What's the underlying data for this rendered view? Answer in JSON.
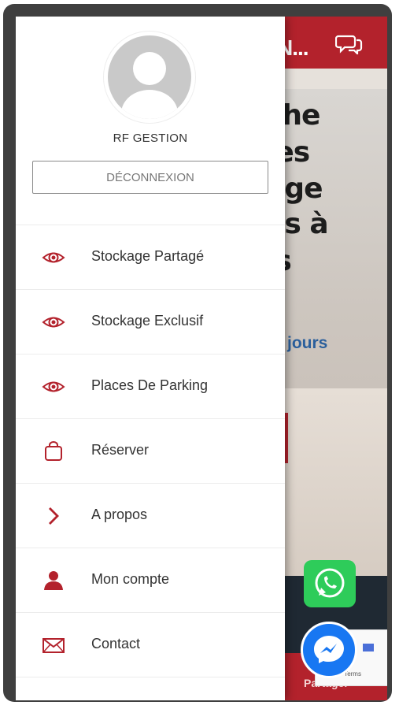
{
  "background_page": {
    "header_text": "N...",
    "headline_lines": [
      "che",
      "les",
      "age",
      "és à",
      "is"
    ],
    "link_text": "jours",
    "share_label": "Partager",
    "recaptcha_text": "Privacy - Terms"
  },
  "drawer": {
    "user_name": "RF GESTION",
    "logout_label": "DÉCONNEXION",
    "menu_items": [
      {
        "label": "Stockage Partagé",
        "icon": "eye-icon"
      },
      {
        "label": "Stockage Exclusif",
        "icon": "eye-icon"
      },
      {
        "label": "Places De Parking",
        "icon": "eye-icon"
      },
      {
        "label": "Réserver",
        "icon": "shopping-bag-icon"
      },
      {
        "label": "A propos",
        "icon": "chevron-right-icon"
      },
      {
        "label": "Mon compte",
        "icon": "user-icon"
      },
      {
        "label": "Contact",
        "icon": "envelope-icon"
      }
    ]
  },
  "colors": {
    "brand_red": "#b3222c",
    "whatsapp_green": "#2ecc5a",
    "messenger_blue": "#1877f2"
  }
}
